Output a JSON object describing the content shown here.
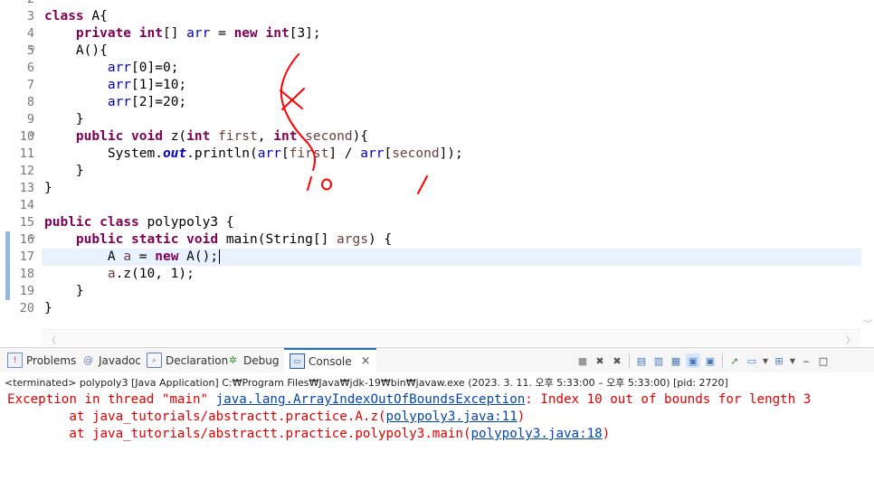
{
  "editor": {
    "line_numbers": [
      "2",
      "3",
      "4",
      "5",
      "6",
      "7",
      "8",
      "9",
      "10",
      "11",
      "12",
      "13",
      "14",
      "15",
      "16",
      "17",
      "18",
      "19",
      "20"
    ],
    "fold_marks": {
      "l5": "⊖",
      "l10": "⊖",
      "l16": "⊖"
    },
    "code": {
      "l3": {
        "kw_class": "class",
        "rest": " A{"
      },
      "l4": {
        "kw_private": "private",
        "kw_int": "int",
        "t1": "[] ",
        "fld_arr": "arr",
        "t2": " = ",
        "kw_new": "new",
        "kw_int2": "int",
        "t3": "[3];"
      },
      "l5": {
        "text": "A(){"
      },
      "l6": {
        "fld": "arr",
        "t": "[0]=0;"
      },
      "l7": {
        "fld": "arr",
        "t": "[1]=10;"
      },
      "l8": {
        "fld": "arr",
        "t": "[2]=20;"
      },
      "l9": {
        "text": "}"
      },
      "l10": {
        "kw_public": "public",
        "kw_void": "void",
        "t1": " z(",
        "kw_int": "int",
        "var_first": "first",
        "t2": ", ",
        "kw_int2": "int",
        "var_second": "second",
        "t3": "){"
      },
      "l11": {
        "t1": "System.",
        "sf_out": "out",
        "t2": ".println(",
        "fld_arr": "arr",
        "t3": "[",
        "var_first": "first",
        "t4": "] / ",
        "fld_arr2": "arr",
        "t5": "[",
        "var_second": "second",
        "t6": "]);"
      },
      "l12": {
        "text": "}"
      },
      "l13": {
        "text": "}"
      },
      "l15": {
        "kw_public": "public",
        "kw_class": "class",
        "rest": " polypoly3 {"
      },
      "l16": {
        "kw_public": "public",
        "kw_static": "static",
        "kw_void": "void",
        "t1": " main(String[] ",
        "var_args": "args",
        "t2": ") {"
      },
      "l17": {
        "t1": "A ",
        "var_a": "a",
        "t2": " = ",
        "kw_new": "new",
        "t3": " A();"
      },
      "l18": {
        "var_a": "a",
        "t": ".z(10, 1);"
      },
      "l19": {
        "text": "}"
      },
      "l20": {
        "text": "}"
      }
    },
    "annotations": {
      "ten": "1 0",
      "one": "/"
    }
  },
  "panel": {
    "tabs": {
      "problems": "Problems",
      "javadoc": "Javadoc",
      "declaration": "Declaration",
      "debug": "Debug",
      "console": "Console",
      "close": "×"
    },
    "tab_icons": {
      "problems": "problems-icon",
      "javadoc": "at-icon",
      "declaration": "declaration-icon",
      "debug": "bug-icon",
      "console": "console-icon"
    },
    "status": "<terminated> polypoly3 [Java Application] C:₩Program Files₩Java₩jdk-19₩bin₩javaw.exe  (2023. 3. 11. 오후 5:33:00 – 오후 5:33:00) [pid: 2720]",
    "output": {
      "l1_pre": "Exception in thread \"main\" ",
      "l1_link": "java.lang.ArrayIndexOutOfBoundsException",
      "l1_post": ": Index 10 out of bounds for length 3",
      "l2_pre": "        at java_tutorials/abstractt.practice.A.z(",
      "l2_link": "polypoly3.java:11",
      "l2_post": ")",
      "l3_pre": "        at java_tutorials/abstractt.practice.polypoly3.main(",
      "l3_link": "polypoly3.java:18",
      "l3_post": ")"
    }
  },
  "colors": {
    "keyword": "#7f0055",
    "field": "#0000c0",
    "local": "#6a3e3e",
    "error": "#e00000",
    "link": "#0645ad",
    "ink": "#ff0000",
    "current_line": "#e8f2fe"
  }
}
